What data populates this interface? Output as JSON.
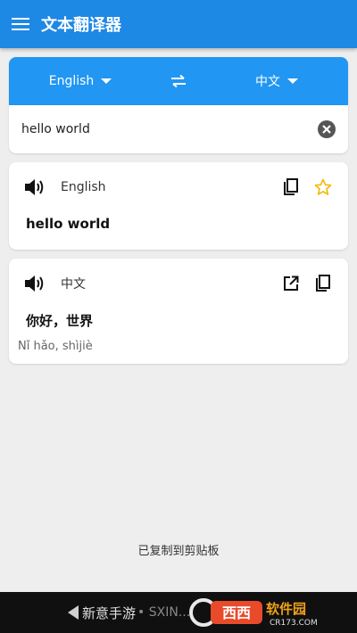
{
  "app": {
    "title": "文本翻译器",
    "accent_color": "#1e88e5",
    "lang_bar_color": "#2196f3"
  },
  "language_selector": {
    "source": "English",
    "target": "中文",
    "swap_icon": "swap-arrows-icon"
  },
  "input": {
    "value": "hello world",
    "clear_icon": "clear-circle-icon"
  },
  "result_card": {
    "language": "English",
    "text": "hello world",
    "icons": [
      "speaker-icon",
      "copy-icon",
      "star-icon"
    ]
  },
  "translation_card": {
    "language": "中文",
    "text": "你好，世界",
    "pinyin": "Nǐ hǎo, shìjiè",
    "icons": [
      "speaker-icon",
      "open-external-icon",
      "copy-icon"
    ]
  },
  "toast": {
    "message": "已复制到剪贴板"
  },
  "navbar": {
    "text": "新意手游",
    "dim_text": "• SXIN...",
    "watermark": "西西软件园 CR173.COM"
  }
}
